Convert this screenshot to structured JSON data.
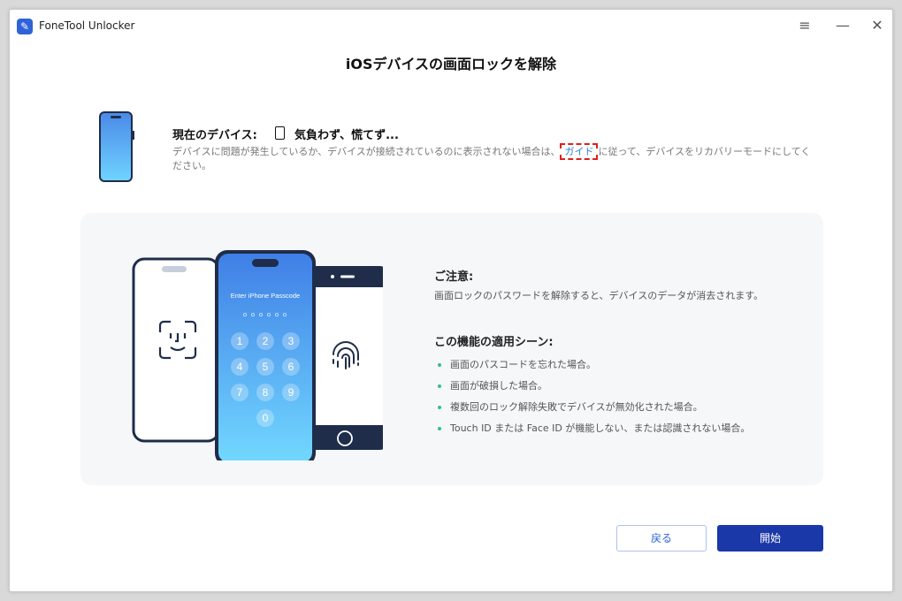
{
  "app": {
    "title": "FoneTool Unlocker",
    "logo_glyph": "✎"
  },
  "titlebar": {
    "menu_glyph": "≡",
    "minimize_glyph": "—",
    "close_glyph": "✕"
  },
  "page": {
    "title": "iOSデバイスの画面ロックを解除"
  },
  "device": {
    "label": "現在のデバイス:",
    "name": "気負わず、慌てず...",
    "desc_before": "デバイスに問題が発生しているか、デバイスが接続されているのに表示されない場合は、",
    "guide_link": "ガイド",
    "desc_after": "に従って、デバイスをリカバリーモードにしてください。"
  },
  "illustration": {
    "passcode_prompt": "Enter iPhone Passcode",
    "keypad": [
      "1",
      "2",
      "3",
      "4",
      "5",
      "6",
      "7",
      "8",
      "9",
      "0"
    ]
  },
  "notice": {
    "title": "ご注意:",
    "text": "画面ロックのパスワードを解除すると、デバイスのデータが消去されます。"
  },
  "scenes": {
    "title": "この機能の適用シーン:",
    "items": [
      "画面のパスコードを忘れた場合。",
      "画面が破損した場合。",
      "複数回のロック解除失敗でデバイスが無効化された場合。",
      "Touch ID または Face ID が機能しない、または認識されない場合。"
    ]
  },
  "buttons": {
    "back": "戻る",
    "start": "開始"
  },
  "colors": {
    "accent": "#1b38a8",
    "link": "#2f7fe0",
    "bullet": "#2fbf8f",
    "phone_gradient_top": "#3f7fe6",
    "phone_gradient_bottom": "#72d8ff",
    "phone_frame": "#1f2d4a"
  }
}
